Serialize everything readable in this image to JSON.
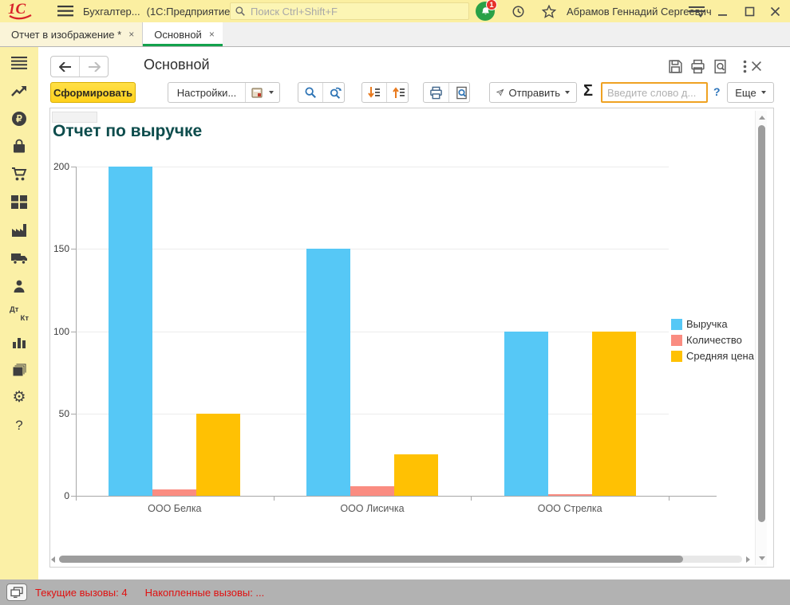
{
  "topbar": {
    "logo": "1С",
    "app_title": "Бухгалтер...",
    "app_context": "(1С:Предприятие)",
    "search_placeholder": "Поиск Ctrl+Shift+F",
    "notification_badge": "1",
    "user_name": "Абрамов Геннадий Сергеевич"
  },
  "tabs": [
    {
      "label": "Отчет в изображение *",
      "close_label": "×",
      "active": "false"
    },
    {
      "label": "Основной",
      "close_label": "×",
      "active": "true"
    }
  ],
  "sidebar": {
    "items": [
      "sections-menu-icon",
      "managers-icon",
      "bank-cash-icon",
      "sales-icon",
      "purchases-icon",
      "warehouse-icon",
      "production-icon",
      "fixed-assets-icon",
      "staff-icon",
      "operations-icon",
      "reports-icon",
      "directories-icon",
      "administration-icon",
      "help-icon"
    ],
    "operations_label_top": "Дт",
    "operations_label_bottom": "Кт",
    "administration_glyph": "⚙",
    "help_label": "?"
  },
  "form": {
    "title": "Основной",
    "toolbar": {
      "generate_label": "Сформировать",
      "settings_label": "Настройки...",
      "send_label": "Отправить",
      "sum_label": "Σ",
      "filter_placeholder": "Введите слово д...",
      "help_label": "?",
      "more_label": "Еще"
    }
  },
  "chart_data": {
    "type": "bar",
    "title": "Отчет по выручке",
    "title_color": "#0d4c4c",
    "categories": [
      "ООО Белка",
      "ООО Лисичка",
      "ООО Стрелка"
    ],
    "series": [
      {
        "name": "Выручка",
        "color": "#56c8f6",
        "values": [
          200,
          150,
          100
        ]
      },
      {
        "name": "Количество",
        "color": "#fa8c81",
        "values": [
          4,
          6,
          1
        ]
      },
      {
        "name": "Средняя цена",
        "color": "#ffc103",
        "values": [
          50,
          25,
          100
        ]
      }
    ],
    "ylim": [
      0,
      200
    ],
    "yticks": [
      0,
      50,
      100,
      150,
      200
    ],
    "grid": true,
    "legend_position": "right"
  },
  "statusbar": {
    "current_calls": "Текущие вызовы: 4",
    "accumulated_calls": "Накопленные вызовы: ..."
  }
}
